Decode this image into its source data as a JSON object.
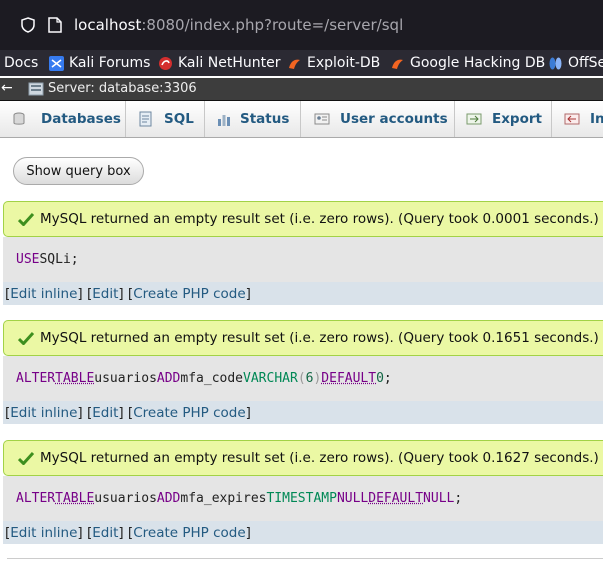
{
  "browser": {
    "url_host": "localhost",
    "url_rest": ":8080/index.php?route=/server/sql",
    "bookmarks": [
      {
        "label": "Docs"
      },
      {
        "label": "Kali Forums"
      },
      {
        "label": "Kali NetHunter"
      },
      {
        "label": "Exploit-DB"
      },
      {
        "label": "Google Hacking DB"
      },
      {
        "label": "OffSe"
      }
    ]
  },
  "server": {
    "back": "←",
    "label": "Server: database:3306"
  },
  "tabs": [
    {
      "label": "Databases",
      "icon": "database-icon"
    },
    {
      "label": "SQL",
      "icon": "sql-icon"
    },
    {
      "label": "Status",
      "icon": "status-icon"
    },
    {
      "label": "User accounts",
      "icon": "user-accounts-icon"
    },
    {
      "label": "Export",
      "icon": "export-icon"
    },
    {
      "label": "In",
      "icon": "import-icon"
    }
  ],
  "show_query_label": "Show query box",
  "results": [
    {
      "message": "MySQL returned an empty result set (i.e. zero rows). (Query took 0.0001 seconds.)",
      "sql": {
        "t1": "USE",
        "t2": " SQLi;"
      }
    },
    {
      "message": "MySQL returned an empty result set (i.e. zero rows). (Query took 0.1651 seconds.)",
      "sql": {
        "t1": "ALTER",
        "t2": " ",
        "t3": "TABLE",
        "t4": " usuarios ",
        "t5": "ADD",
        "t6": " mfa_code ",
        "t7": "VARCHAR",
        "t8": " (",
        "t9": "6",
        "t10": ") ",
        "t11": "DEFAULT",
        "t12": " ",
        "t13": "0",
        "t14": ";"
      }
    },
    {
      "message": "MySQL returned an empty result set (i.e. zero rows). (Query took 0.1627 seconds.)",
      "sql": {
        "t1": "ALTER",
        "t2": " ",
        "t3": "TABLE",
        "t4": " usuarios ",
        "t5": "ADD",
        "t6": " mfa_expires ",
        "t7": "TIMESTAMP",
        "t8": " ",
        "t9": "NULL",
        "t10": " ",
        "t11": "DEFAULT",
        "t12": " ",
        "t13": "NULL",
        "t14": ";"
      }
    }
  ],
  "result_links": {
    "open1": "[ ",
    "edit_inline": "Edit inline",
    "sep1": " ] [ ",
    "edit": "Edit",
    "sep2": " ] [ ",
    "create_php": "Create PHP code",
    "close": " ]"
  },
  "colors": {
    "success_bg": "#ebf8a4",
    "success_border": "#a2d246",
    "link": "#235a81",
    "sql_keyword": "#770088"
  }
}
